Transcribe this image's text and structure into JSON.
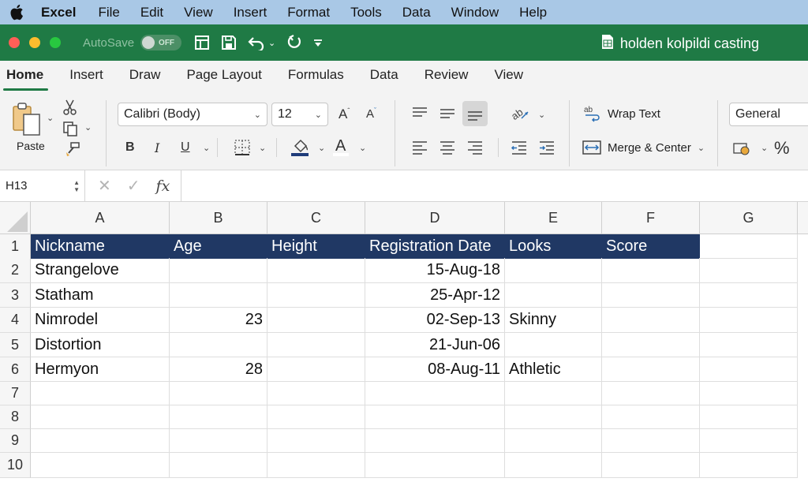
{
  "menubar": {
    "app_name": "Excel",
    "items": [
      "File",
      "Edit",
      "View",
      "Insert",
      "Format",
      "Tools",
      "Data",
      "Window",
      "Help"
    ]
  },
  "titlebar": {
    "autosave_label": "AutoSave",
    "autosave_state": "OFF",
    "document_title": "holden kolpildi casting"
  },
  "ribbon_tabs": [
    "Home",
    "Insert",
    "Draw",
    "Page Layout",
    "Formulas",
    "Data",
    "Review",
    "View"
  ],
  "ribbon": {
    "paste_label": "Paste",
    "font_name": "Calibri (Body)",
    "font_size": "12",
    "bold": "B",
    "italic": "I",
    "underline": "U",
    "wrap_text": "Wrap Text",
    "merge_center": "Merge & Center",
    "number_format": "General",
    "percent": "%"
  },
  "formula_bar": {
    "name_box": "H13",
    "fx_label": "fx",
    "formula": ""
  },
  "sheet": {
    "columns": [
      "A",
      "B",
      "C",
      "D",
      "E",
      "F",
      "G"
    ],
    "row_numbers": [
      "1",
      "2",
      "3",
      "4",
      "5",
      "6",
      "7",
      "8",
      "9",
      "10"
    ],
    "header": [
      "Nickname",
      "Age",
      "Height",
      "Registration Date",
      "Looks",
      "Score"
    ],
    "rows": [
      [
        "Strangelove",
        "",
        "",
        "15-Aug-18",
        "",
        ""
      ],
      [
        "Statham",
        "",
        "",
        "25-Apr-12",
        "",
        ""
      ],
      [
        "Nimrodel",
        "23",
        "",
        "02-Sep-13",
        "Skinny",
        ""
      ],
      [
        "Distortion",
        "",
        "",
        "21-Jun-06",
        "",
        ""
      ],
      [
        "Hermyon",
        "28",
        "",
        "08-Aug-11",
        "Athletic",
        ""
      ]
    ]
  },
  "colors": {
    "title_bar": "#1f7a45",
    "menu_bar": "#a9c8e6",
    "header_fill": "#203864",
    "header_text": "#ffffff"
  }
}
